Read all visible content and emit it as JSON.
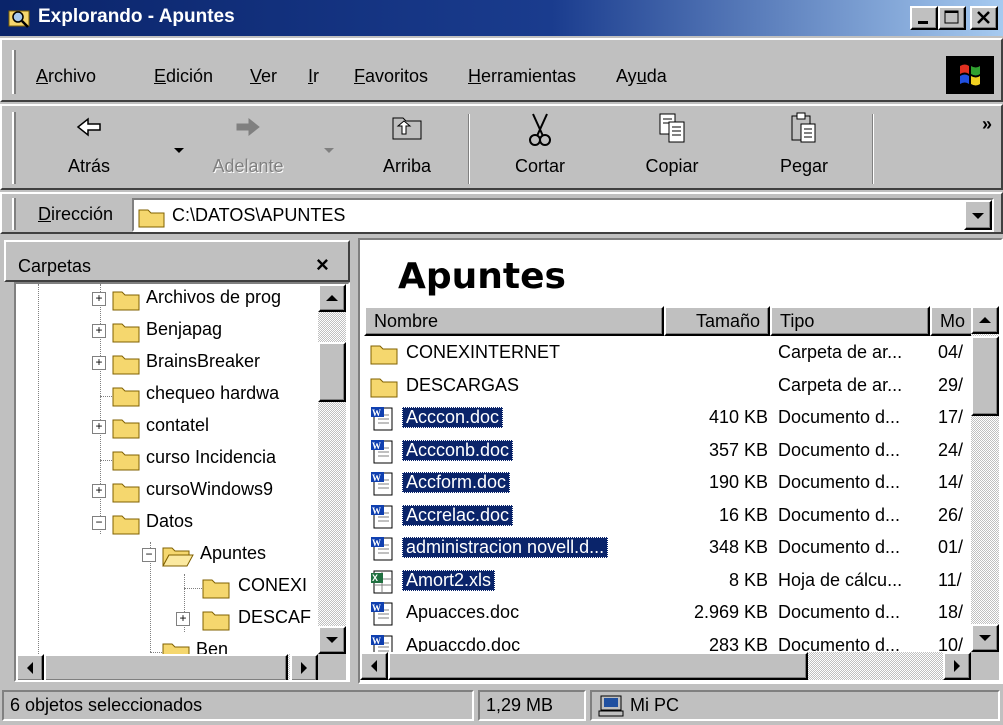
{
  "window": {
    "title": "Explorando - Apuntes",
    "icon": "explorer-magnifier-folder-icon",
    "colors": {
      "titlebar_start": "#0a246a",
      "titlebar_end": "#a6caf0",
      "selection": "#0a246a",
      "face": "#c0c0c0"
    }
  },
  "menu": {
    "items": [
      {
        "label": "Archivo",
        "mnemonic": "A"
      },
      {
        "label": "Edición",
        "mnemonic": "E"
      },
      {
        "label": "Ver",
        "mnemonic": "V"
      },
      {
        "label": "Ir",
        "mnemonic": "I"
      },
      {
        "label": "Favoritos",
        "mnemonic": "F"
      },
      {
        "label": "Herramientas",
        "mnemonic": "H"
      },
      {
        "label": "Ayuda",
        "mnemonic": "u"
      }
    ]
  },
  "toolbar": {
    "back": {
      "label": "Atrás",
      "icon": "back-arrow-icon"
    },
    "forward": {
      "label": "Adelante",
      "icon": "forward-arrow-icon",
      "disabled": true
    },
    "up": {
      "label": "Arriba",
      "icon": "up-folder-icon"
    },
    "cut": {
      "label": "Cortar",
      "icon": "scissors-icon"
    },
    "copy": {
      "label": "Copiar",
      "icon": "copy-icon"
    },
    "paste": {
      "label": "Pegar",
      "icon": "paste-icon"
    },
    "overflow": "»"
  },
  "address": {
    "label": "Dirección",
    "value": "C:\\DATOS\\APUNTES"
  },
  "folders_panel": {
    "title": "Carpetas",
    "close": "×",
    "tree": [
      {
        "label": "Archivos de prog",
        "expander": "+"
      },
      {
        "label": "Benjapag",
        "expander": "+"
      },
      {
        "label": "BrainsBreaker",
        "expander": "+"
      },
      {
        "label": "chequeo hardwa",
        "expander": ""
      },
      {
        "label": "contatel",
        "expander": "+"
      },
      {
        "label": "curso Incidencia",
        "expander": ""
      },
      {
        "label": "cursoWindows9",
        "expander": "+"
      },
      {
        "label": "Datos",
        "expander": "−"
      },
      {
        "label": "Apuntes",
        "expander": "−"
      },
      {
        "label": "CONEXI",
        "expander": ""
      },
      {
        "label": "DESCAF",
        "expander": "+"
      },
      {
        "label": "Ben",
        "expander": ""
      }
    ]
  },
  "content": {
    "heading": "Apuntes",
    "columns": [
      "Nombre",
      "Tamaño",
      "Tipo",
      "Mo"
    ],
    "files": [
      {
        "name": "CONEXINTERNET",
        "size": "",
        "type": "Carpeta de ar...",
        "mod": "04/",
        "icon": "folder-icon",
        "selected": false
      },
      {
        "name": "DESCARGAS",
        "size": "",
        "type": "Carpeta de ar...",
        "mod": "29/",
        "icon": "folder-icon",
        "selected": false
      },
      {
        "name": "Acccon.doc",
        "size": "410 KB",
        "type": "Documento d...",
        "mod": "17/",
        "icon": "word-doc-icon",
        "selected": true
      },
      {
        "name": "Accconb.doc",
        "size": "357 KB",
        "type": "Documento d...",
        "mod": "24/",
        "icon": "word-doc-icon",
        "selected": true
      },
      {
        "name": "Accform.doc",
        "size": "190 KB",
        "type": "Documento d...",
        "mod": "14/",
        "icon": "word-doc-icon",
        "selected": true
      },
      {
        "name": "Accrelac.doc",
        "size": "16 KB",
        "type": "Documento d...",
        "mod": "26/",
        "icon": "word-doc-icon",
        "selected": true
      },
      {
        "name": "administracion novell.d...",
        "size": "348 KB",
        "type": "Documento d...",
        "mod": "01/",
        "icon": "word-doc-icon",
        "selected": true
      },
      {
        "name": "Amort2.xls",
        "size": "8 KB",
        "type": "Hoja de cálcu...",
        "mod": "11/",
        "icon": "excel-sheet-icon",
        "selected": true
      },
      {
        "name": "Apuacces.doc",
        "size": "2.969 KB",
        "type": "Documento d...",
        "mod": "18/",
        "icon": "word-doc-icon",
        "selected": false
      },
      {
        "name": "Apuaccdo.doc",
        "size": "283 KB",
        "type": "Documento d...",
        "mod": "10/",
        "icon": "word-doc-icon",
        "selected": false
      }
    ]
  },
  "status": {
    "selection": "6 objetos seleccionados",
    "size": "1,29 MB",
    "location": "Mi PC"
  }
}
